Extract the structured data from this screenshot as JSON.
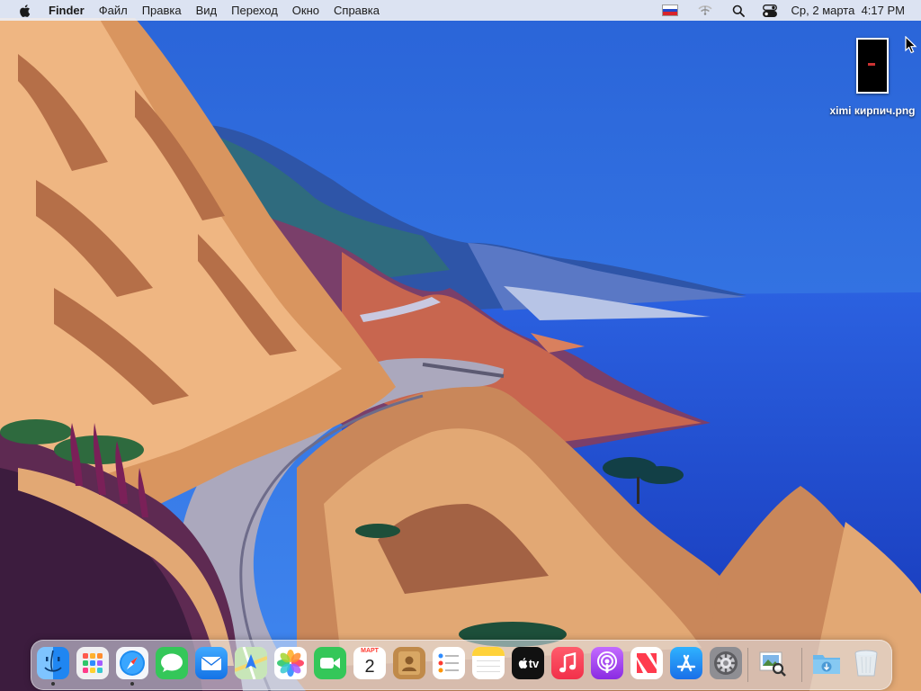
{
  "menubar": {
    "apple_icon": "apple-logo-icon",
    "app_name": "Finder",
    "menus": [
      "Файл",
      "Правка",
      "Вид",
      "Переход",
      "Окно",
      "Справка"
    ],
    "status_icons": [
      "russian-flag-input-source-icon",
      "wifi-icon",
      "spotlight-search-icon",
      "control-center-icon"
    ],
    "clock": "Ср, 2 марта  4:17 PM"
  },
  "desktop": {
    "file_name": "ximi кирпич.png"
  },
  "dock": {
    "apps": [
      {
        "name": "Finder",
        "icon": "finder-icon",
        "running": true
      },
      {
        "name": "Launchpad",
        "icon": "launchpad-icon",
        "running": false
      },
      {
        "name": "Safari",
        "icon": "safari-icon",
        "running": true
      },
      {
        "name": "Messages",
        "icon": "messages-icon",
        "running": false
      },
      {
        "name": "Mail",
        "icon": "mail-icon",
        "running": false
      },
      {
        "name": "Maps",
        "icon": "maps-icon",
        "running": false
      },
      {
        "name": "Photos",
        "icon": "photos-icon",
        "running": false
      },
      {
        "name": "FaceTime",
        "icon": "facetime-icon",
        "running": false
      },
      {
        "name": "Calendar",
        "icon": "calendar-icon",
        "running": false,
        "month": "МАРТ",
        "day": "2"
      },
      {
        "name": "Contacts",
        "icon": "contacts-icon",
        "running": false
      },
      {
        "name": "Reminders",
        "icon": "reminders-icon",
        "running": false
      },
      {
        "name": "Notes",
        "icon": "notes-icon",
        "running": false
      },
      {
        "name": "TV",
        "icon": "apple-tv-icon",
        "running": false,
        "label": "tv"
      },
      {
        "name": "Music",
        "icon": "music-icon",
        "running": false
      },
      {
        "name": "Podcasts",
        "icon": "podcasts-icon",
        "running": false
      },
      {
        "name": "News",
        "icon": "news-icon",
        "running": false
      },
      {
        "name": "App Store",
        "icon": "app-store-icon",
        "running": false
      },
      {
        "name": "System Preferences",
        "icon": "system-preferences-icon",
        "running": false
      },
      {
        "name": "Preview",
        "icon": "preview-icon",
        "running": false
      },
      {
        "name": "Downloads",
        "icon": "downloads-folder-icon",
        "running": false
      },
      {
        "name": "Trash",
        "icon": "trash-icon",
        "running": false
      }
    ]
  },
  "colors": {
    "sky": "#2f6fe0",
    "ocean": "#1f4fd6",
    "cliff": "#e0a56e",
    "road": "#a9a7bb"
  }
}
